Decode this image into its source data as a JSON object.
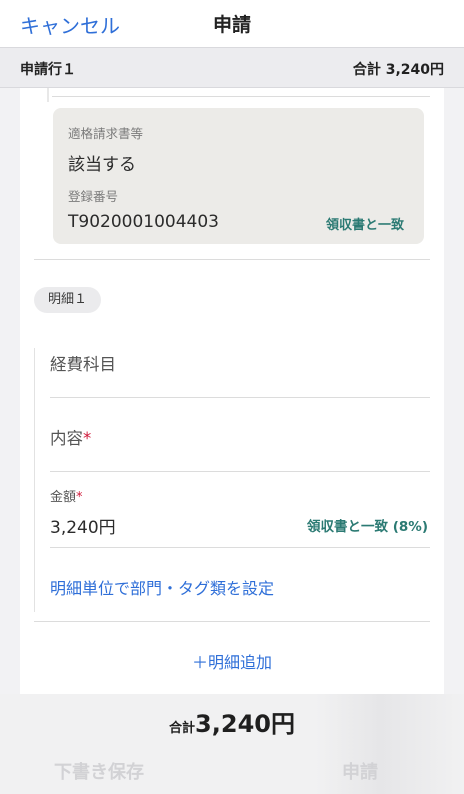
{
  "nav": {
    "cancel_label": "キャンセル",
    "title": "申請"
  },
  "subheader": {
    "line_label": "申請行１",
    "total_label": "合計 3,240円"
  },
  "invoice_card": {
    "qualified_label": "適格請求書等",
    "qualified_value": "該当する",
    "registration_label": "登録番号",
    "registration_value": "T9020001004403",
    "match_label": "領収書と一致"
  },
  "detail": {
    "chip_label": "明細１",
    "expense_item_label": "経費科目",
    "content_label": "内容",
    "amount_label": "金額",
    "required_mark": "*",
    "amount_value": "3,240円",
    "amount_match": "領収書と一致 (8%)",
    "dept_tag_link": "明細単位で部門・タグ類を設定",
    "add_detail": "＋明細追加"
  },
  "footer": {
    "total_label": "合計",
    "total_value": "3,240円",
    "draft_button": "下書き保存",
    "submit_button": "申請"
  },
  "colors": {
    "link_blue": "#2f6fd8",
    "match_teal": "#2b7a73",
    "required_red": "#d0193a",
    "disabled_gray": "#d2d2d5"
  }
}
